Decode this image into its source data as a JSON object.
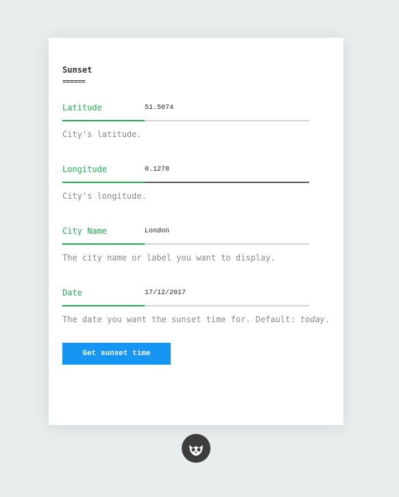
{
  "form": {
    "title": "Sunset",
    "title_underline": "======",
    "fields": [
      {
        "label": "Latitude",
        "value": "51.5074",
        "help": "City's latitude."
      },
      {
        "label": "Longitude",
        "value": "0.1278",
        "help": "City's longitude."
      },
      {
        "label": "City Name",
        "value": "London",
        "help": "The city name or label you want to display."
      },
      {
        "label": "Date",
        "value": "17/12/2017",
        "help_prefix": "The date you want the sunset time for. Default: ",
        "help_emphasis": "today",
        "help_suffix": "."
      }
    ],
    "submit_label": "Get sunset time"
  },
  "colors": {
    "accent": "#1fae4f",
    "button": "#1696f2",
    "background": "#e8eded"
  },
  "footer": {
    "logo_icon": "owl-icon"
  }
}
